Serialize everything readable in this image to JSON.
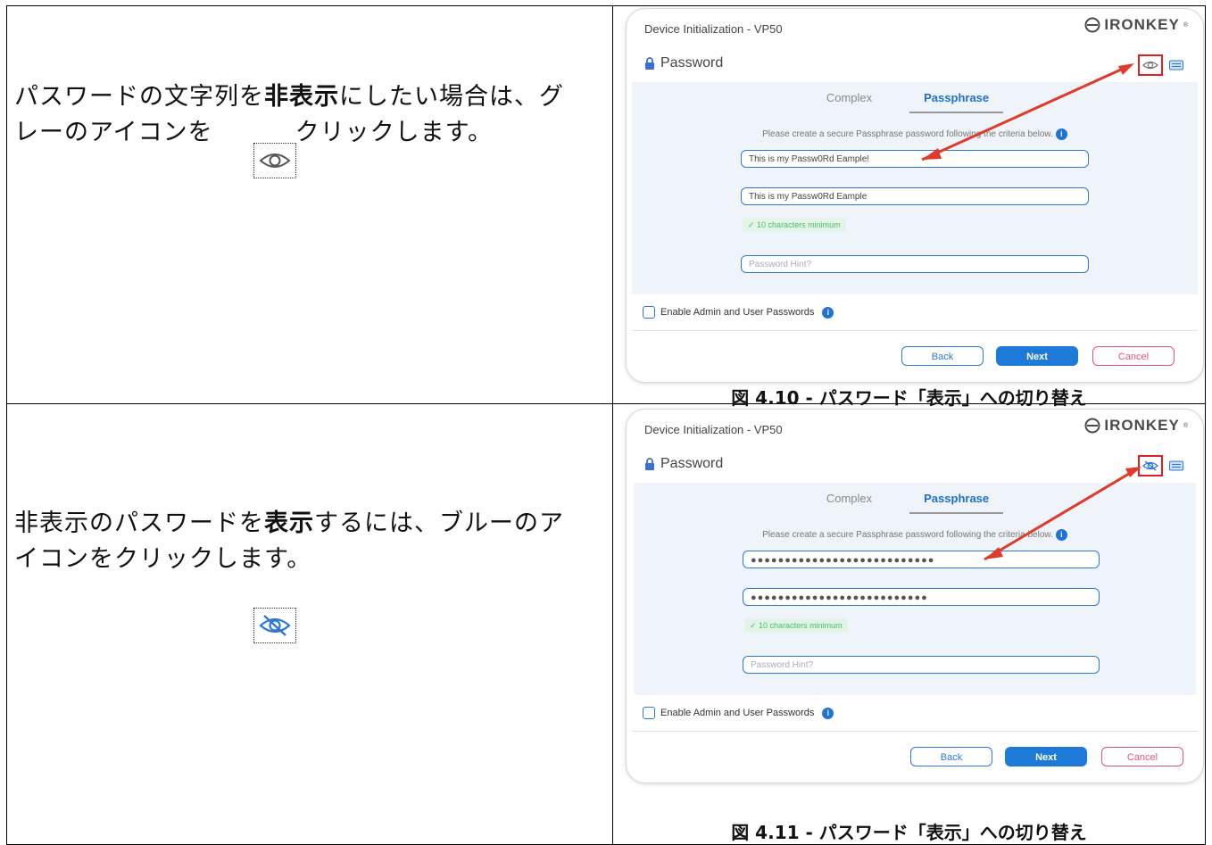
{
  "row1": {
    "instruction_pre": "パスワードの文字列を",
    "instruction_bold": "非表示",
    "instruction_post": "にしたい場合は、グ",
    "instruction_line2a": "レーのアイコンを",
    "instruction_line2b": "クリックします。",
    "caption": "図 4.10 - パスワード「表示」への切り替え",
    "field1_value": "This is my Passw0Rd Eample!",
    "field2_value": "This is my Passw0Rd Eample"
  },
  "row2": {
    "instruction_pre": "非表示のパスワードを",
    "instruction_bold": "表示",
    "instruction_post": "するには、ブルーのア",
    "instruction_line2": "イコンをクリックします。",
    "caption": "図 4.11 - パスワード「表示」への切り替え",
    "field1_value": "●●●●●●●●●●●●●●●●●●●●●●●●●●●",
    "field2_value": "●●●●●●●●●●●●●●●●●●●●●●●●●●"
  },
  "dialog": {
    "title": "Device Initialization - VP50",
    "brand": "IRONKEY",
    "brand_mark": "®",
    "section": "Password",
    "tab_complex": "Complex",
    "tab_passphrase": "Passphrase",
    "criteria": "Please create a secure Passphrase password following the criteria below.",
    "min_chars": "✓ 10 characters minimum",
    "hint_placeholder": "Password Hint?",
    "enable_label": "Enable Admin and User Passwords",
    "btn_back": "Back",
    "btn_next": "Next",
    "btn_cancel": "Cancel"
  },
  "colors": {
    "accent_blue": "#1e7ad8",
    "annotation_red": "#e02020",
    "cancel_pink": "#e05580",
    "success_green": "#42c36b"
  },
  "icons": [
    "eye-icon",
    "eye-slash-icon",
    "lock-icon",
    "keyboard-icon",
    "info-icon",
    "ironkey-logo-icon"
  ]
}
